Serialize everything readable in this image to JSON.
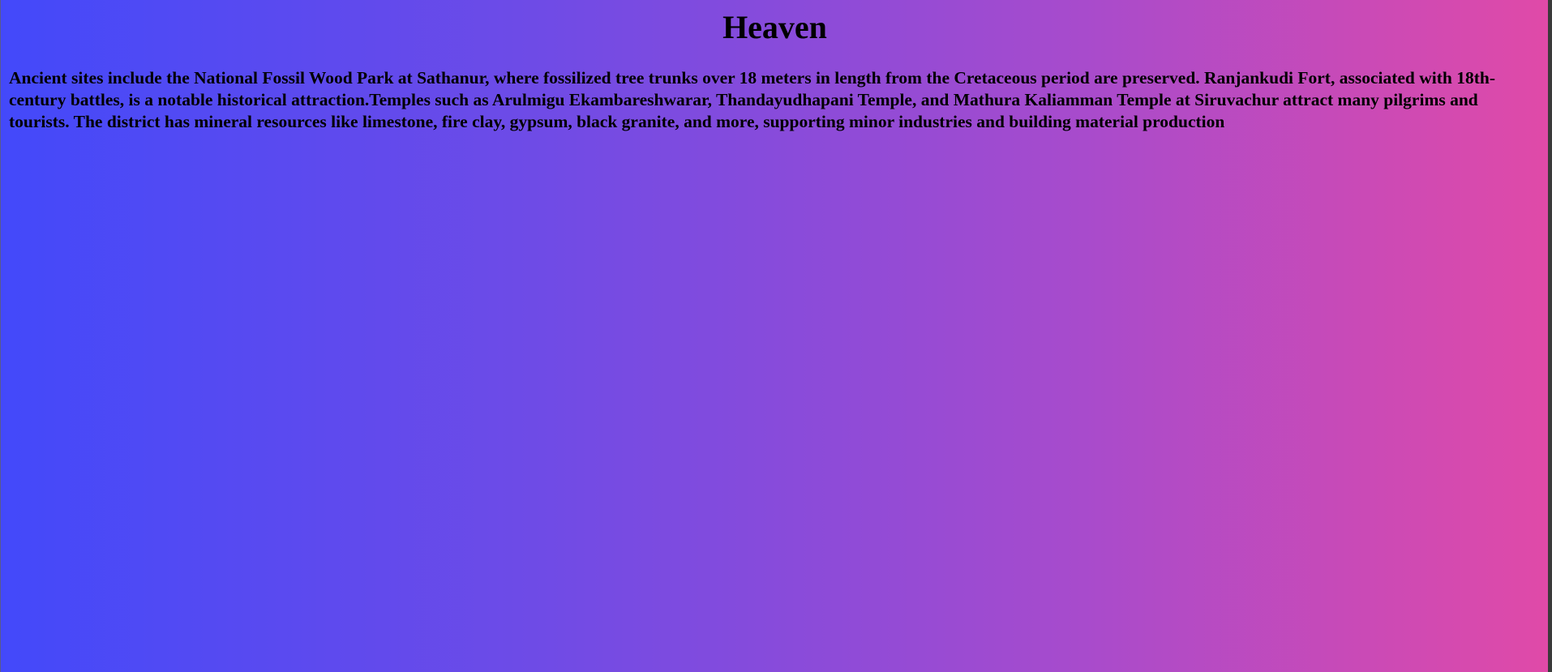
{
  "page": {
    "heading": "Heaven",
    "paragraph": "Ancient sites include the National Fossil Wood Park at Sathanur, where fossilized tree trunks over 18 meters in length from the Cretaceous period are preserved. Ranjankudi Fort, associated with 18th-century battles, is a notable historical attraction.Temples such as Arulmigu Ekambareshwarar, Thandayudhapani Temple, and Mathura Kaliamman Temple at Siruvachur attract many pilgrims and tourists. The district has mineral resources like limestone, fire clay, gypsum, black granite, and more, supporting minor industries and building material production"
  },
  "colors": {
    "gradient_start": "#4349fa",
    "gradient_mid": "#a84bcc",
    "gradient_end": "#e04aa8",
    "text": "#000000"
  }
}
